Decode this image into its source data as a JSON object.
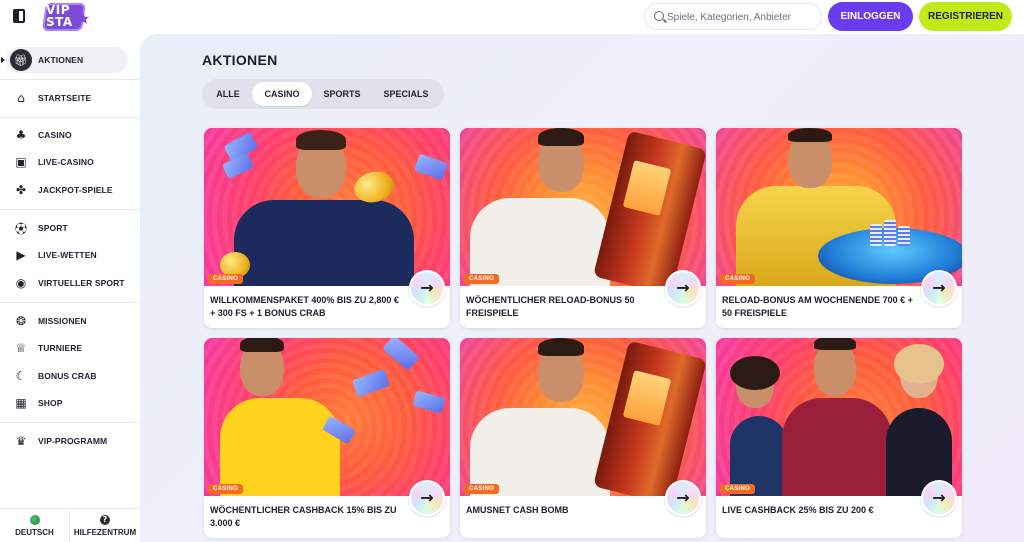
{
  "header": {
    "logo_text": "VIP STA",
    "search_placeholder": "Spiele, Kategorien, Anbieter",
    "login_label": "EINLOGGEN",
    "register_label": "REGISTRIEREN",
    "colors": {
      "login": "#6a3cf0",
      "register": "#c2ea1a"
    }
  },
  "sidebar": {
    "items": [
      {
        "label": "AKTIONEN",
        "icon": "gift-icon",
        "active": true
      },
      {
        "label": "STARTSEITE",
        "icon": "home-icon"
      },
      {
        "label": "CASINO",
        "icon": "cherries-icon"
      },
      {
        "label": "LIVE-CASINO",
        "icon": "live-dealer-icon"
      },
      {
        "label": "JACKPOT-SPIELE",
        "icon": "clover-icon"
      },
      {
        "label": "SPORT",
        "icon": "soccer-ball-icon"
      },
      {
        "label": "LIVE-WETTEN",
        "icon": "live-play-icon"
      },
      {
        "label": "VIRTUELLER SPORT",
        "icon": "gamepad-icon"
      },
      {
        "label": "MISSIONEN",
        "icon": "missions-icon"
      },
      {
        "label": "TURNIERE",
        "icon": "trophy-icon"
      },
      {
        "label": "BONUS CRAB",
        "icon": "crab-claw-icon"
      },
      {
        "label": "SHOP",
        "icon": "shop-icon"
      },
      {
        "label": "VIP-PROGRAMM",
        "icon": "crown-icon"
      }
    ],
    "footer": {
      "language_label": "DEUTSCH",
      "help_label": "HILFEZENTRUM"
    }
  },
  "main": {
    "title": "AKTIONEN",
    "tabs": [
      {
        "label": "ALLE"
      },
      {
        "label": "CASINO",
        "active": true
      },
      {
        "label": "SPORTS"
      },
      {
        "label": "SPECIALS"
      }
    ],
    "cards": [
      {
        "badge": "CASINO",
        "title": "WILLKOMMENSPAKET 400% BIS ZU 2,800 € + 300 FS + 1 BONUS CRAB"
      },
      {
        "badge": "CASINO",
        "title": "WÖCHENTLICHER RELOAD-BONUS 50 FREISPIELE"
      },
      {
        "badge": "CASINO",
        "title": "RELOAD-BONUS AM WOCHENENDE 700 € + 50 FREISPIELE"
      },
      {
        "badge": "CASINO",
        "title": "WÖCHENTLICHER CASHBACK 15% BIS ZU 3.000 €"
      },
      {
        "badge": "CASINO",
        "title": "AMUSNET CASH BOMB"
      },
      {
        "badge": "CASINO",
        "title": "LIVE CASHBACK 25% BIS ZU 200 €"
      }
    ]
  }
}
